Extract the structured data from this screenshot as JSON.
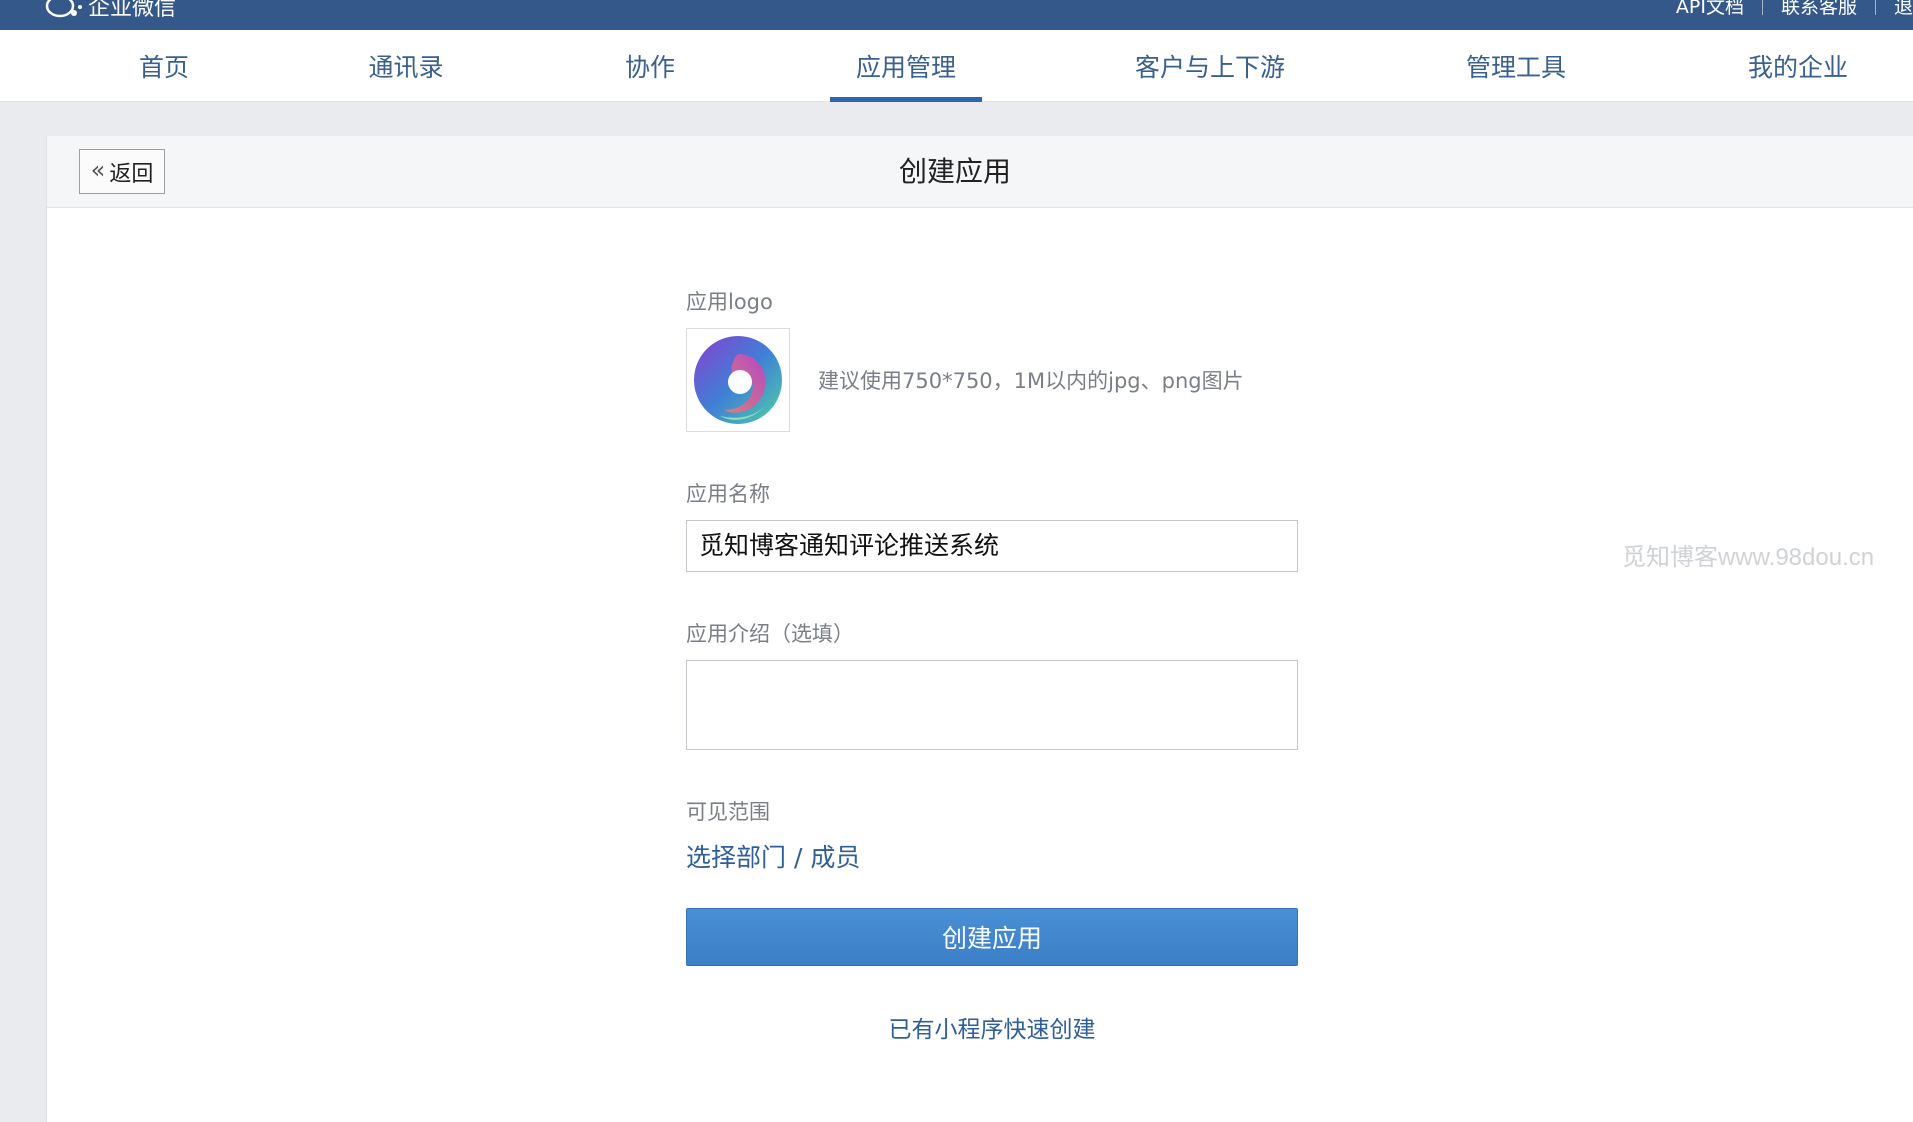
{
  "topbar": {
    "brand": "企业微信",
    "links": [
      "API文档",
      "联系客服",
      "退"
    ]
  },
  "nav": {
    "items": [
      {
        "label": "首页",
        "active": false
      },
      {
        "label": "通讯录",
        "active": false
      },
      {
        "label": "协作",
        "active": false
      },
      {
        "label": "应用管理",
        "active": true
      },
      {
        "label": "客户与上下游",
        "active": false
      },
      {
        "label": "管理工具",
        "active": false
      },
      {
        "label": "我的企业",
        "active": false
      }
    ]
  },
  "header": {
    "back_label": "返回",
    "title": "创建应用"
  },
  "form": {
    "logo_label": "应用logo",
    "logo_hint": "建议使用750*750，1M以内的jpg、png图片",
    "name_label": "应用名称",
    "name_value": "觅知博客通知评论推送系统",
    "intro_label": "应用介绍（选填）",
    "intro_value": "",
    "scope_label": "可见范围",
    "scope_link": "选择部门 / 成员",
    "submit_label": "创建应用",
    "quick_create_link": "已有小程序快速创建"
  },
  "watermark": "觅知博客www.98dou.cn",
  "colors": {
    "topbar": "#35588a",
    "nav_text": "#39608f",
    "nav_active_underline": "#2f66b3",
    "primary_button": "#3a7fc7",
    "link": "#2f5f99"
  }
}
